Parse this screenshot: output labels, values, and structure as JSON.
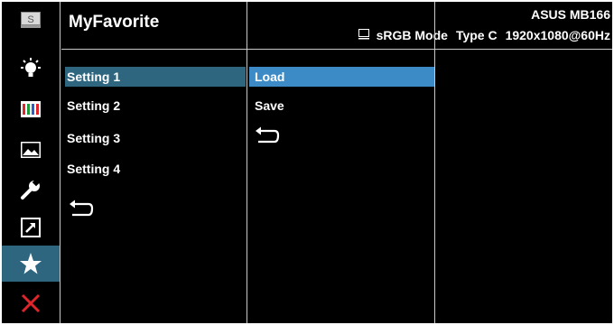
{
  "header": {
    "title": "MyFavorite",
    "model": "ASUS MB166",
    "color_mode": "sRGB Mode",
    "input": "Type C",
    "resolution": "1920x1080@60Hz"
  },
  "sidebar": {
    "items": [
      {
        "icon": "splendid-icon",
        "selected": false
      },
      {
        "icon": "blue-light-filter-icon",
        "selected": false
      },
      {
        "icon": "color-icon",
        "selected": false
      },
      {
        "icon": "image-icon",
        "selected": false
      },
      {
        "icon": "system-setup-icon",
        "selected": false
      },
      {
        "icon": "shortcut-icon",
        "selected": false
      },
      {
        "icon": "star-icon",
        "selected": true
      },
      {
        "icon": "close-icon",
        "selected": false
      }
    ]
  },
  "menu": {
    "settings": [
      "Setting 1",
      "Setting 2",
      "Setting 3",
      "Setting 4"
    ],
    "selected_setting": "Setting 1",
    "actions": [
      "Load",
      "Save"
    ],
    "selected_action": "Load"
  },
  "colors": {
    "selected_row": "#2e6680",
    "selected_action": "#3d8bc6",
    "close_icon": "#e0262b"
  }
}
